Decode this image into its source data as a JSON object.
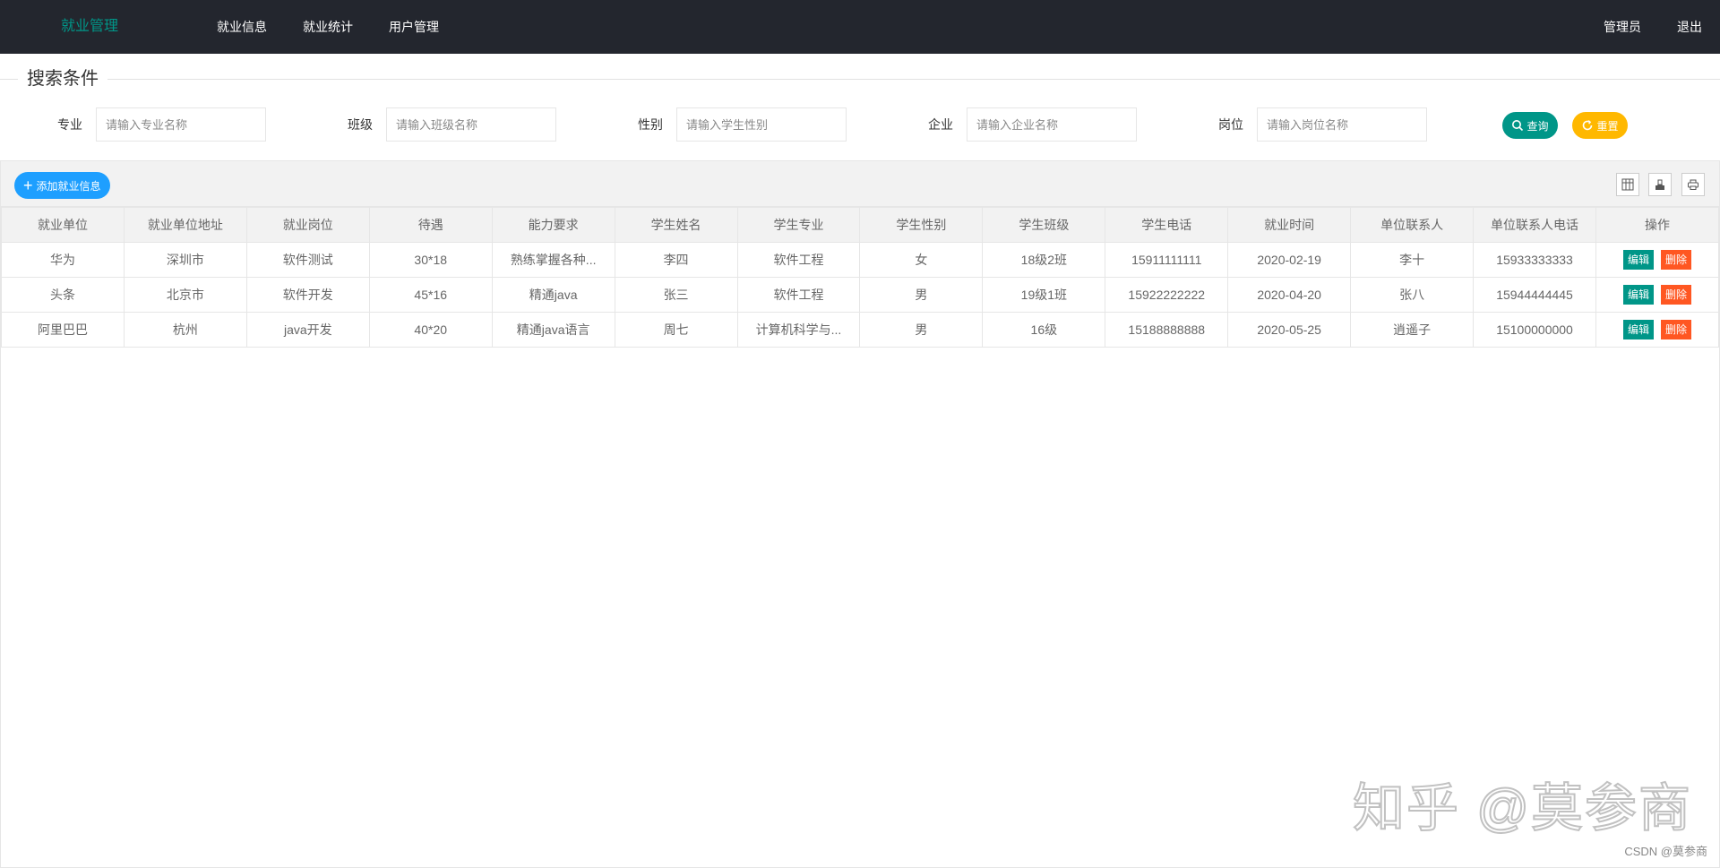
{
  "app": {
    "brand": "就业管理"
  },
  "nav": {
    "items": [
      "就业信息",
      "就业统计",
      "用户管理"
    ],
    "user": "管理员",
    "logout": "退出"
  },
  "search": {
    "legend": "搜索条件",
    "fields": [
      {
        "label": "专业",
        "placeholder": "请输入专业名称"
      },
      {
        "label": "班级",
        "placeholder": "请输入班级名称"
      },
      {
        "label": "性别",
        "placeholder": "请输入学生性别"
      },
      {
        "label": "企业",
        "placeholder": "请输入企业名称"
      },
      {
        "label": "岗位",
        "placeholder": "请输入岗位名称"
      }
    ],
    "query_label": "查询",
    "reset_label": "重置"
  },
  "toolbar": {
    "add_label": "添加就业信息"
  },
  "table": {
    "headers": [
      "就业单位",
      "就业单位地址",
      "就业岗位",
      "待遇",
      "能力要求",
      "学生姓名",
      "学生专业",
      "学生性别",
      "学生班级",
      "学生电话",
      "就业时间",
      "单位联系人",
      "单位联系人电话",
      "操作"
    ],
    "rows": [
      [
        "华为",
        "深圳市",
        "软件测试",
        "30*18",
        "熟练掌握各种...",
        "李四",
        "软件工程",
        "女",
        "18级2班",
        "15911111111",
        "2020-02-19",
        "李十",
        "15933333333"
      ],
      [
        "头条",
        "北京市",
        "软件开发",
        "45*16",
        "精通java",
        "张三",
        "软件工程",
        "男",
        "19级1班",
        "15922222222",
        "2020-04-20",
        "张八",
        "15944444445"
      ],
      [
        "阿里巴巴",
        "杭州",
        "java开发",
        "40*20",
        "精通java语言",
        "周七",
        "计算机科学与...",
        "男",
        "16级",
        "15188888888",
        "2020-05-25",
        "逍遥子",
        "15100000000"
      ]
    ],
    "edit_label": "编辑",
    "delete_label": "删除"
  },
  "watermark": {
    "text": "知乎 @莫参商",
    "small": "CSDN @莫参商"
  },
  "colors": {
    "topbar": "#23262e",
    "brand": "#009688",
    "query": "#009688",
    "reset": "#ffb800",
    "add": "#1e9fff",
    "edit": "#009688",
    "delete": "#ff5722"
  }
}
